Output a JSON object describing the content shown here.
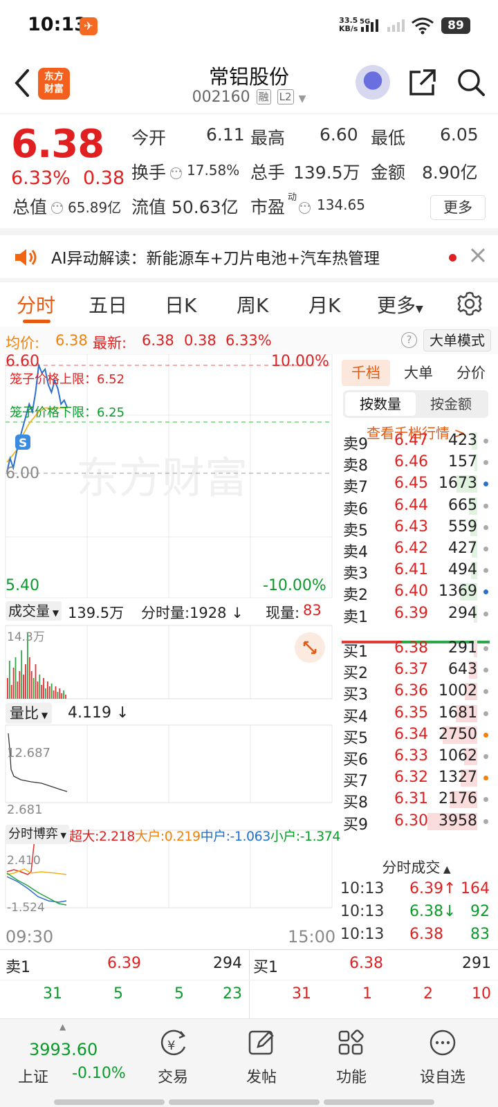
{
  "status_bar": {
    "time": "10:13",
    "net_speed": "33.5",
    "net_unit": "KB/s",
    "net_type": "5G",
    "battery": "89"
  },
  "header": {
    "logo_line1": "东方",
    "logo_line2": "财富",
    "stock_name": "常铝股份",
    "stock_code": "002160",
    "tag_margin": "融",
    "tag_level": "L2"
  },
  "quote": {
    "price": "6.38",
    "change_pct": "6.33%",
    "change": "0.38",
    "open_label": "今开",
    "open": "6.11",
    "high_label": "最高",
    "high": "6.60",
    "low_label": "最低",
    "low": "6.05",
    "turnover_label": "换手",
    "turnover": "17.58%",
    "volume_label": "总手",
    "volume": "139.5万",
    "amount_label": "金额",
    "amount": "8.90亿",
    "mcap_label": "总值",
    "mcap": "65.89亿",
    "float_label": "流值",
    "float_mcap": "50.63亿",
    "pe_label": "市盈",
    "pe_sup": "动",
    "pe": "134.65",
    "more": "更多"
  },
  "ai_banner": {
    "text": "AI异动解读：新能源车+刀片电池+汽车热管理"
  },
  "tabs": [
    "分时",
    "五日",
    "日K",
    "周K",
    "月K",
    "更多"
  ],
  "info": {
    "avg_label": "均价:",
    "avg": "6.38",
    "last_label": "最新:",
    "last": "6.38",
    "chg": "0.38",
    "pct": "6.33%",
    "mode_button": "大单模式"
  },
  "chart": {
    "y_top": "6.60",
    "y_mid": "6.00",
    "y_bottom": "5.40",
    "pct_top": "10.00%",
    "pct_bottom": "-10.00%",
    "cage_upper": "笼子价格上限：6.52",
    "cage_lower": "笼子价格下限：6.25",
    "watermark": "东方财富",
    "s_badge": "S",
    "vol_selector": "成交量",
    "vol_total": "139.5万",
    "vol_min": "分时量:1928 ↓",
    "vol_now_label": "现量:",
    "vol_now": "83",
    "vol_max": "14.3万",
    "ratio_selector": "量比",
    "ratio_value": "4.119 ↓",
    "ratio_max": "12.687",
    "ratio_min": "2.681",
    "game_selector": "分时博弈",
    "super_label": "超大:",
    "super": "2.218",
    "big_label": "大户:",
    "big": "0.219",
    "mid_label": "中户:",
    "mid": "-1.063",
    "small_label": "小户:",
    "small": "-1.374",
    "game_max": "2.410",
    "game_min": "-1.524",
    "time_start": "09:30",
    "time_end": "15:00",
    "series": {
      "price": [
        6.05,
        6.12,
        6.07,
        6.15,
        6.22,
        6.28,
        6.34,
        6.4,
        6.36,
        6.46,
        6.6,
        6.56,
        6.58,
        6.5,
        6.46,
        6.52,
        6.48,
        6.4,
        6.42,
        6.38
      ],
      "avg": [
        6.1,
        6.12,
        6.14,
        6.16,
        6.2,
        6.24,
        6.27,
        6.3,
        6.32,
        6.34,
        6.36,
        6.37,
        6.38,
        6.38,
        6.38,
        6.38,
        6.38,
        6.38,
        6.38,
        6.38
      ]
    }
  },
  "right_panel": {
    "tabs": [
      "千档",
      "大单",
      "分价"
    ],
    "seg": [
      "按数量",
      "按金额"
    ],
    "link": "查看千档行情 >",
    "asks": [
      {
        "name": "卖9",
        "price": "6.47",
        "qty": "423"
      },
      {
        "name": "卖8",
        "price": "6.46",
        "qty": "157"
      },
      {
        "name": "卖7",
        "price": "6.45",
        "qty": "1673"
      },
      {
        "name": "卖6",
        "price": "6.44",
        "qty": "665"
      },
      {
        "name": "卖5",
        "price": "6.43",
        "qty": "559"
      },
      {
        "name": "卖4",
        "price": "6.42",
        "qty": "427"
      },
      {
        "name": "卖3",
        "price": "6.41",
        "qty": "494"
      },
      {
        "name": "卖2",
        "price": "6.40",
        "qty": "1369"
      },
      {
        "name": "卖1",
        "price": "6.39",
        "qty": "294"
      }
    ],
    "bids": [
      {
        "name": "买1",
        "price": "6.38",
        "qty": "291"
      },
      {
        "name": "买2",
        "price": "6.37",
        "qty": "643"
      },
      {
        "name": "买3",
        "price": "6.36",
        "qty": "1002"
      },
      {
        "name": "买4",
        "price": "6.35",
        "qty": "1681"
      },
      {
        "name": "买5",
        "price": "6.34",
        "qty": "2750"
      },
      {
        "name": "买6",
        "price": "6.33",
        "qty": "1062"
      },
      {
        "name": "买7",
        "price": "6.32",
        "qty": "1327"
      },
      {
        "name": "买8",
        "price": "6.31",
        "qty": "2176"
      },
      {
        "name": "买9",
        "price": "6.30",
        "qty": "3958"
      }
    ],
    "trades_title": "分时成交",
    "trades": [
      {
        "time": "10:13",
        "price": "6.39↑",
        "qty": "164"
      },
      {
        "time": "10:13",
        "price": "6.38↓",
        "qty": "92"
      },
      {
        "time": "10:13",
        "price": "6.38",
        "qty": "83"
      }
    ]
  },
  "bottom": {
    "sell": {
      "label": "卖1",
      "price": "6.39",
      "qty": "294",
      "row": [
        "31",
        "5",
        "5",
        "23"
      ]
    },
    "buy": {
      "label": "买1",
      "price": "6.38",
      "qty": "291",
      "row": [
        "31",
        "1",
        "2",
        "10"
      ]
    }
  },
  "nav": {
    "index_value": "3993.60",
    "index_name": "上证",
    "index_change": "-0.10%",
    "items": [
      "交易",
      "发帖",
      "功能",
      "设自选"
    ]
  }
}
